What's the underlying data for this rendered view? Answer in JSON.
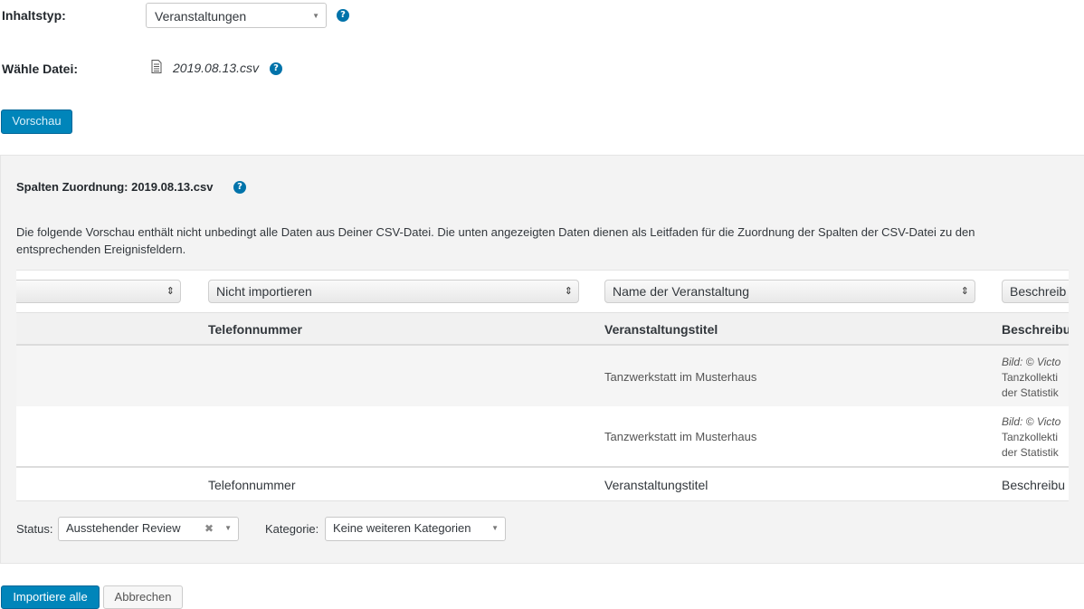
{
  "form": {
    "content_type_label": "Inhaltstyp:",
    "content_type_value": "Veranstaltungen",
    "file_label": "Wähle Datei:",
    "file_name": "2019.08.13.csv",
    "help_glyph": "?",
    "preview_button": "Vorschau"
  },
  "mapping": {
    "title": "Spalten Zuordnung: 2019.08.13.csv",
    "description": "Die folgende Vorschau enthält nicht unbedingt alle Daten aus Deiner CSV-Datei. Die unten angezeigten Daten dienen als Leitfaden für die Zuordnung der Spalten der CSV-Datei zu den entsprechenden Ereignisfeldern.",
    "column_selects": [
      "",
      "Nicht importieren",
      "Name der Veranstaltung",
      "Beschreib"
    ],
    "headers": [
      "",
      "Telefonnummer",
      "Veranstaltungstitel",
      "Beschreibu"
    ],
    "rows": [
      {
        "col1": "",
        "col2": "",
        "col3": "Tanzwerkstatt im Musterhaus",
        "desc_italic": "Bild: © Victo",
        "desc_l2": "Tanzkollekti",
        "desc_l3": "der Statistik"
      },
      {
        "col1": "",
        "col2": "",
        "col3": "Tanzwerkstatt im Musterhaus",
        "desc_italic": "Bild: © Victo",
        "desc_l2": "Tanzkollekti",
        "desc_l3": "der Statistik"
      }
    ],
    "footer": [
      "",
      "Telefonnummer",
      "Veranstaltungstitel",
      "Beschreibu"
    ],
    "status_label": "Status:",
    "status_value": "Ausstehender Review",
    "category_label": "Kategorie:",
    "category_value": "Keine weiteren Kategorien"
  },
  "actions": {
    "import_all": "Importiere alle",
    "cancel": "Abbrechen"
  },
  "icons": {
    "file": "document-icon",
    "help": "help-icon",
    "caret": "chevron-down-icon",
    "updown": "updown-arrows-icon",
    "clear": "clear-icon"
  },
  "colors": {
    "primary": "#0085ba",
    "help": "#0073aa",
    "panel_bg": "#f3f3f3"
  }
}
